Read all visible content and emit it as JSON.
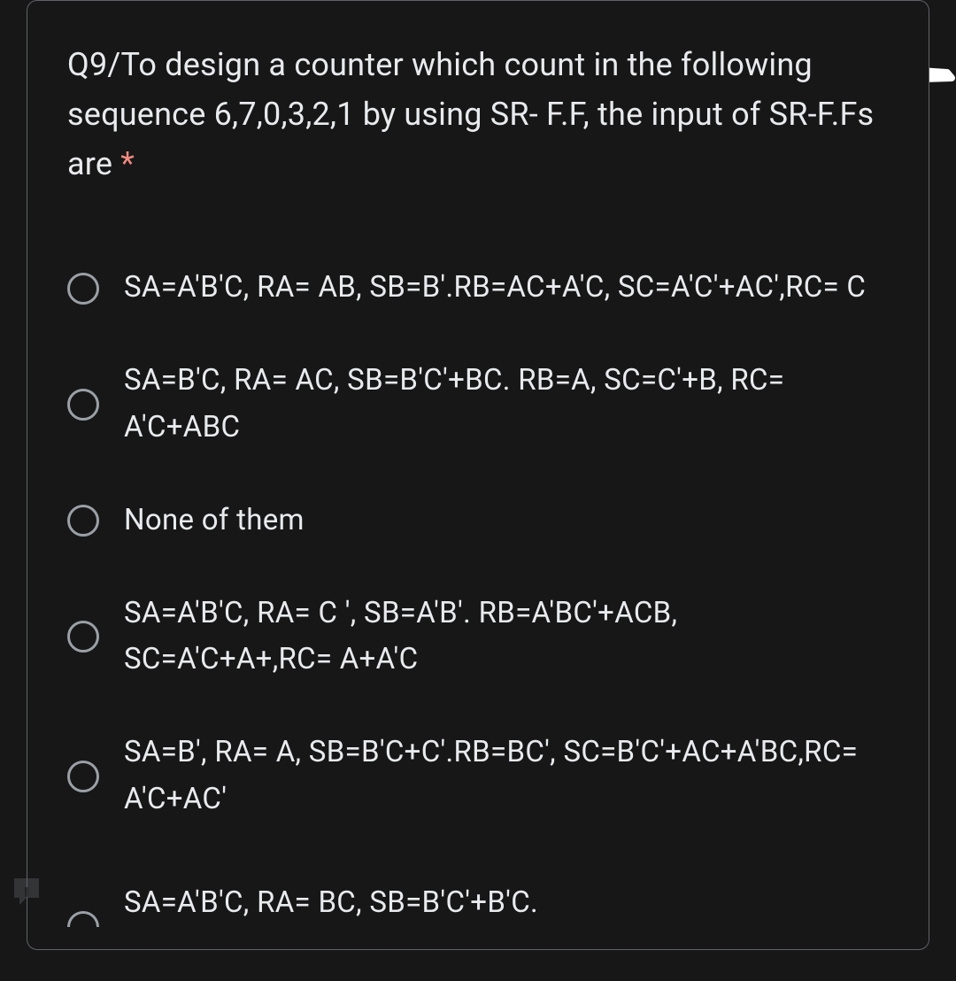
{
  "question": {
    "text": "Q9/To design a counter which count in the following sequence 6,7,0,3,2,1 by using SR- F.F, the input of SR-F.Fs are ",
    "required": "*"
  },
  "options": [
    {
      "text": "SA=A'B'C, RA= AB, SB=B'.RB=AC+A'C, SC=A'C'+AC',RC= C"
    },
    {
      "text": "SA=B'C, RA= AC, SB=B'C'+BC. RB=A, SC=C'+B, RC= A'C+ABC"
    },
    {
      "text": "None of them"
    },
    {
      "text": "SA=A'B'C, RA= C ', SB=A'B'. RB=A'BC'+ACB, SC=A'C+A+,RC= A+A'C"
    },
    {
      "text": "SA=B', RA= A, SB=B'C+C'.RB=BC', SC=B'C'+AC+A'BC,RC= A'C+AC'"
    },
    {
      "text": "SA=A'B'C, RA= BC, SB=B'C'+B'C."
    }
  ]
}
